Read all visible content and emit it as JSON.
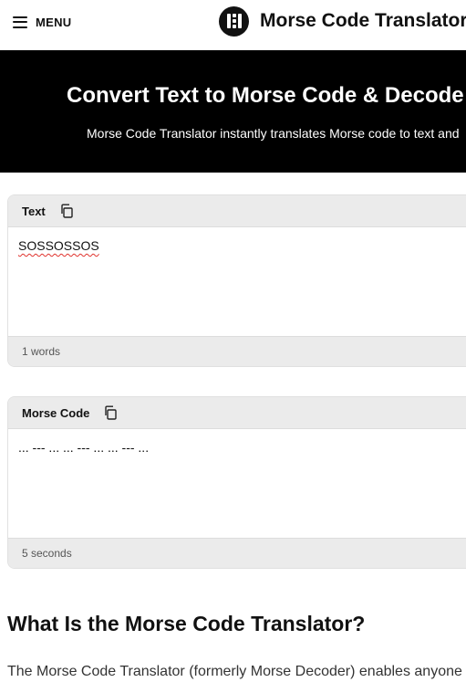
{
  "header": {
    "menu_label": "MENU",
    "brand_title": "Morse Code Translator",
    "icons": [
      "hamburger-icon",
      "logo-icon"
    ]
  },
  "hero": {
    "title": "Convert Text to Morse Code & Decode",
    "subtitle": "Morse Code Translator instantly translates Morse code to text and"
  },
  "text_panel": {
    "label": "Text",
    "value": "SOSSOSSOS",
    "footer": "1 words"
  },
  "morse_panel": {
    "label": "Morse Code",
    "value": "... --- ... ... --- ... ... --- ...",
    "footer": "5 seconds"
  },
  "article": {
    "heading": "What Is the Morse Code Translator?",
    "intro": "The Morse Code Translator (formerly Morse Decoder) enables anyone"
  },
  "colors": {
    "hero_bg": "#000000",
    "panel_header_bg": "#ebebeb",
    "spellcheck_underline": "#e0332e"
  }
}
